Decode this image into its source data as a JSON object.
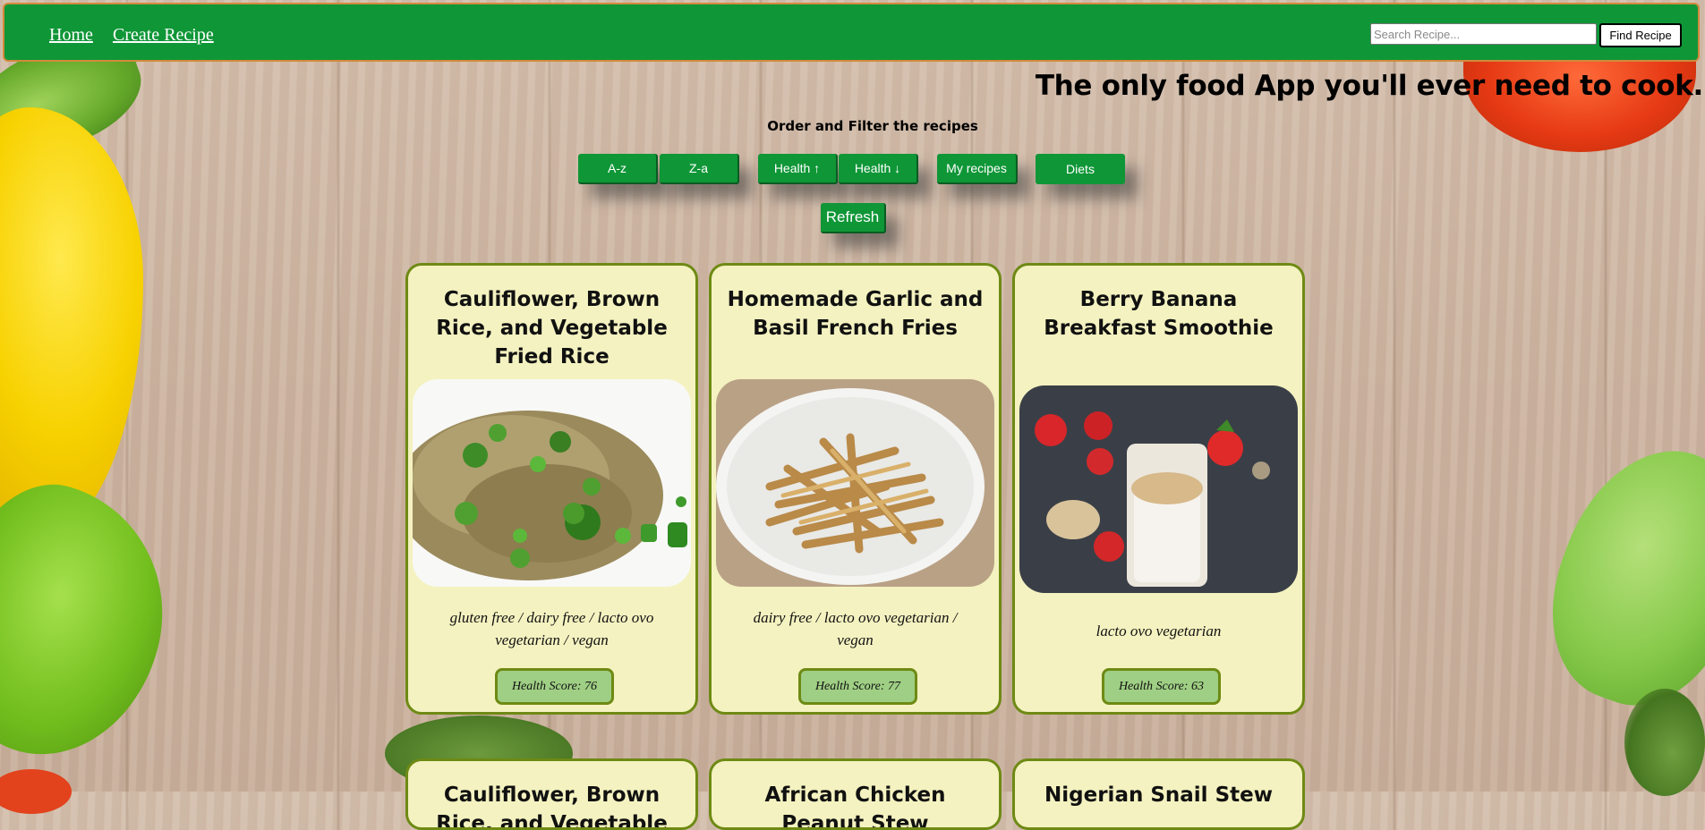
{
  "nav": {
    "home_label": "Home",
    "create_label": "Create Recipe",
    "search_placeholder": "Search Recipe...",
    "find_label": "Find Recipe"
  },
  "tagline": "The only food App you'll ever need to cook.",
  "filters": {
    "heading": "Order and Filter the recipes",
    "az": "A-z",
    "za": "Z-a",
    "health_up": "Health ↑",
    "health_down": "Health ↓",
    "my_recipes": "My recipes",
    "diets": "Diets",
    "refresh": "Refresh"
  },
  "recipes": [
    {
      "title": "Cauliflower, Brown Rice, and Vegetable Fried Rice",
      "diets": "gluten free / dairy free / lacto ovo vegetarian / vegan",
      "health_score": "Health Score: 76",
      "image": "fried-rice-photo"
    },
    {
      "title": "Homemade Garlic and Basil French Fries",
      "diets": "dairy free / lacto ovo vegetarian / vegan",
      "health_score": "Health Score: 77",
      "image": "french-fries-photo"
    },
    {
      "title": "Berry Banana Breakfast Smoothie",
      "diets": "lacto ovo vegetarian",
      "health_score": "Health Score: 63",
      "image": "smoothie-photo"
    }
  ],
  "partial_recipes": [
    {
      "title": "Cauliflower, Brown Rice, and Vegetable Fried Rice"
    },
    {
      "title": "African Chicken Peanut Stew"
    },
    {
      "title": "Nigerian Snail Stew"
    }
  ],
  "colors": {
    "brand_green": "#0f9637",
    "card_bg": "#f4f2c0",
    "card_border": "#6e8a14",
    "badge_bg": "#9fcf84"
  }
}
